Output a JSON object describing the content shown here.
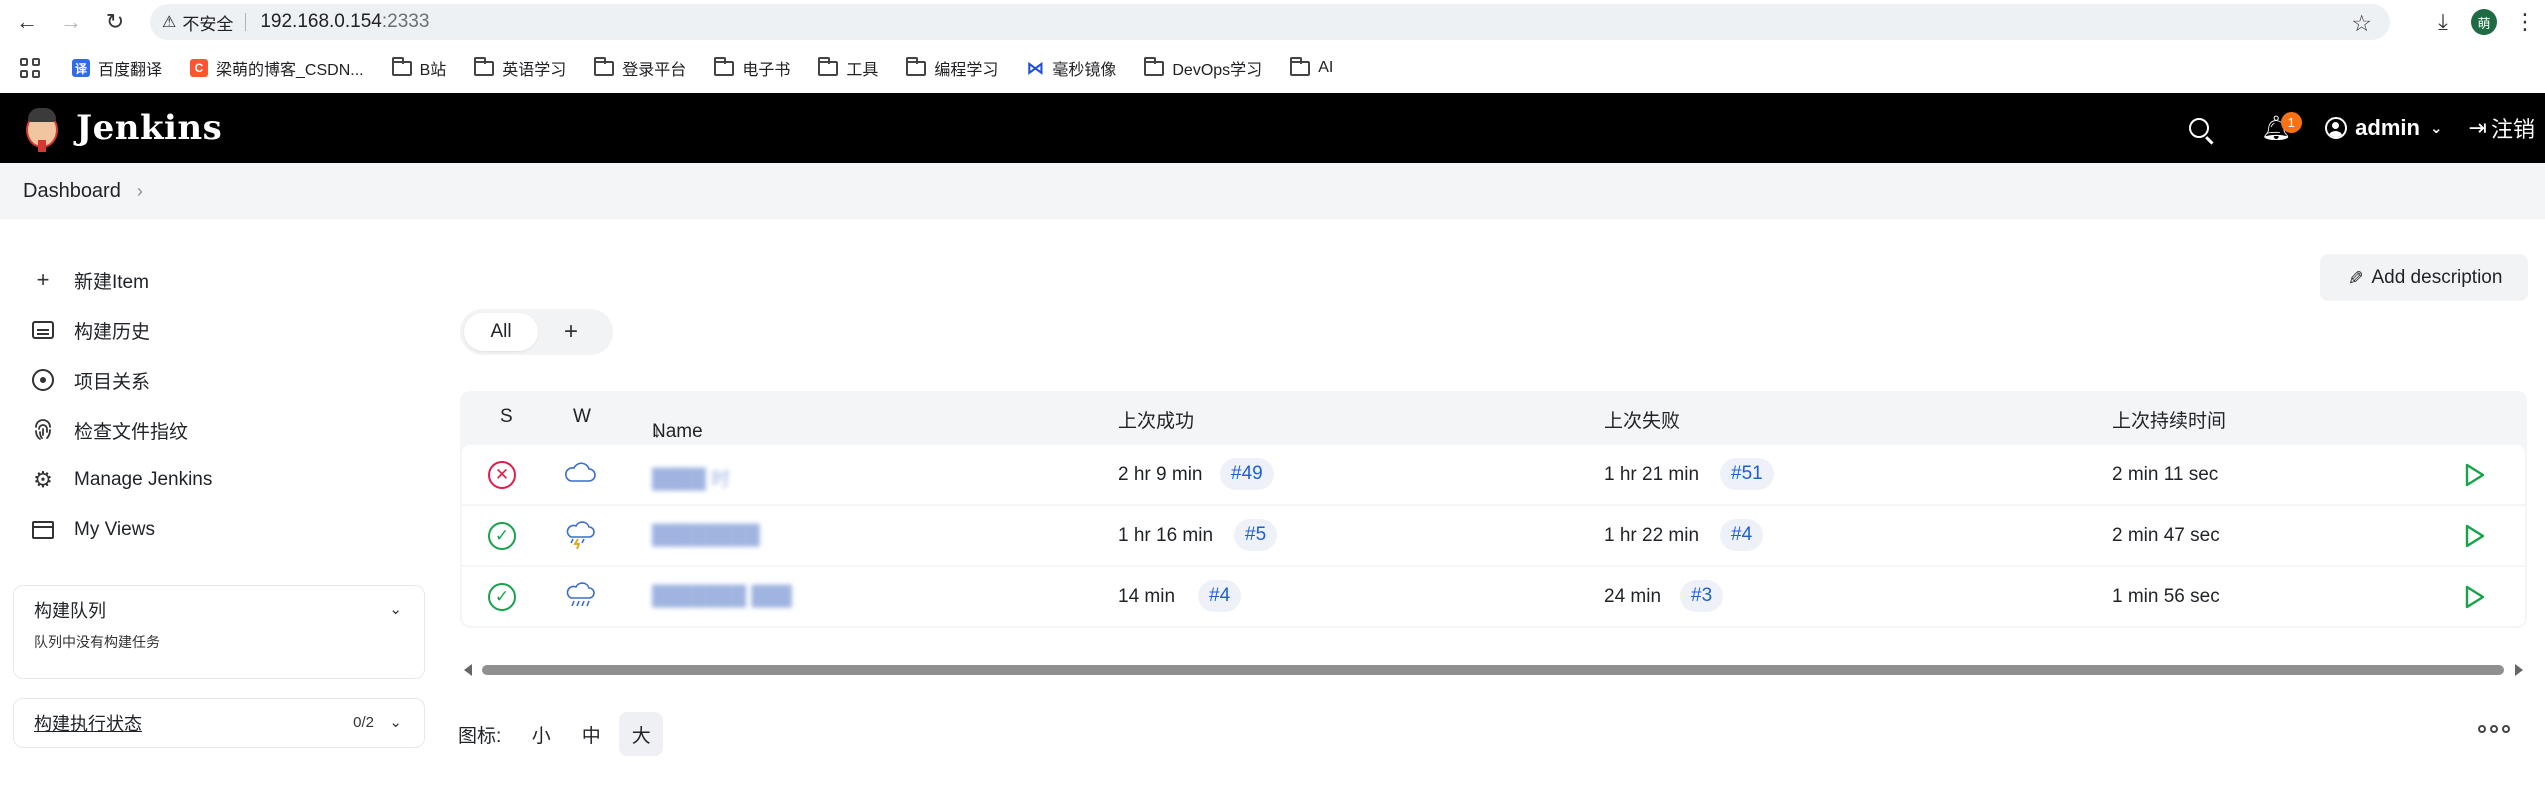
{
  "browser": {
    "insecure_label": "不安全",
    "url_host": "192.168.0.154",
    "url_port": ":2333",
    "profile_initial": "萌",
    "bookmarks": [
      {
        "label": "百度翻译",
        "icon": "translate-icon"
      },
      {
        "label": "梁萌的博客_CSDN...",
        "icon": "csdn-icon"
      },
      {
        "label": "B站",
        "icon": "folder-icon"
      },
      {
        "label": "英语学习",
        "icon": "folder-icon"
      },
      {
        "label": "登录平台",
        "icon": "folder-icon"
      },
      {
        "label": "电子书",
        "icon": "folder-icon"
      },
      {
        "label": "工具",
        "icon": "folder-icon"
      },
      {
        "label": "编程学习",
        "icon": "folder-icon"
      },
      {
        "label": "毫秒镜像",
        "icon": "mirror-icon"
      },
      {
        "label": "DevOps学习",
        "icon": "folder-icon"
      },
      {
        "label": "AI",
        "icon": "folder-icon"
      }
    ]
  },
  "header": {
    "title": "Jenkins",
    "notification_count": "1",
    "user": "admin",
    "logout": "注销"
  },
  "breadcrumb": {
    "root": "Dashboard"
  },
  "tasks": [
    {
      "label": "新建Item",
      "icon": "plus-icon"
    },
    {
      "label": "构建历史",
      "icon": "history-icon"
    },
    {
      "label": "项目关系",
      "icon": "relationship-icon"
    },
    {
      "label": "检查文件指纹",
      "icon": "fingerprint-icon"
    },
    {
      "label": "Manage Jenkins",
      "icon": "gear-icon"
    },
    {
      "label": "My Views",
      "icon": "views-icon"
    }
  ],
  "build_queue": {
    "title": "构建队列",
    "empty_text": "队列中没有构建任务"
  },
  "executors": {
    "title": "构建执行状态",
    "count": "0/2"
  },
  "add_description": "Add description",
  "view_tabs": {
    "all": "All",
    "add": "+"
  },
  "table": {
    "headers": {
      "s": "S",
      "w": "W",
      "name": "Name",
      "sort_arrow": "↓",
      "last_success": "上次成功",
      "last_failure": "上次失败",
      "last_duration": "上次持续时间"
    },
    "rows": [
      {
        "status": "failed",
        "weather": "cloudy",
        "name": "████ 时",
        "last_success": "2 hr 9 min",
        "success_build": "#49",
        "last_failure": "1 hr 21 min",
        "failure_build": "#51",
        "duration": "2 min 11 sec"
      },
      {
        "status": "success",
        "weather": "thunderstorm",
        "name": "████████",
        "last_success": "1 hr 16 min",
        "success_build": "#5",
        "last_failure": "1 hr 22 min",
        "failure_build": "#4",
        "duration": "2 min 47 sec"
      },
      {
        "status": "success",
        "weather": "rain",
        "name": "███████ ███",
        "last_success": "14 min",
        "success_build": "#4",
        "last_failure": "24 min",
        "failure_build": "#3",
        "duration": "1 min 56 sec"
      }
    ]
  },
  "icon_size": {
    "label": "图标:",
    "small": "小",
    "medium": "中",
    "large": "大",
    "selected": "large"
  },
  "colors": {
    "header_bg": "#000000",
    "failed": "#e11d48",
    "success": "#16a34a",
    "link": "#1d5fd1",
    "badge": "#f97316"
  }
}
